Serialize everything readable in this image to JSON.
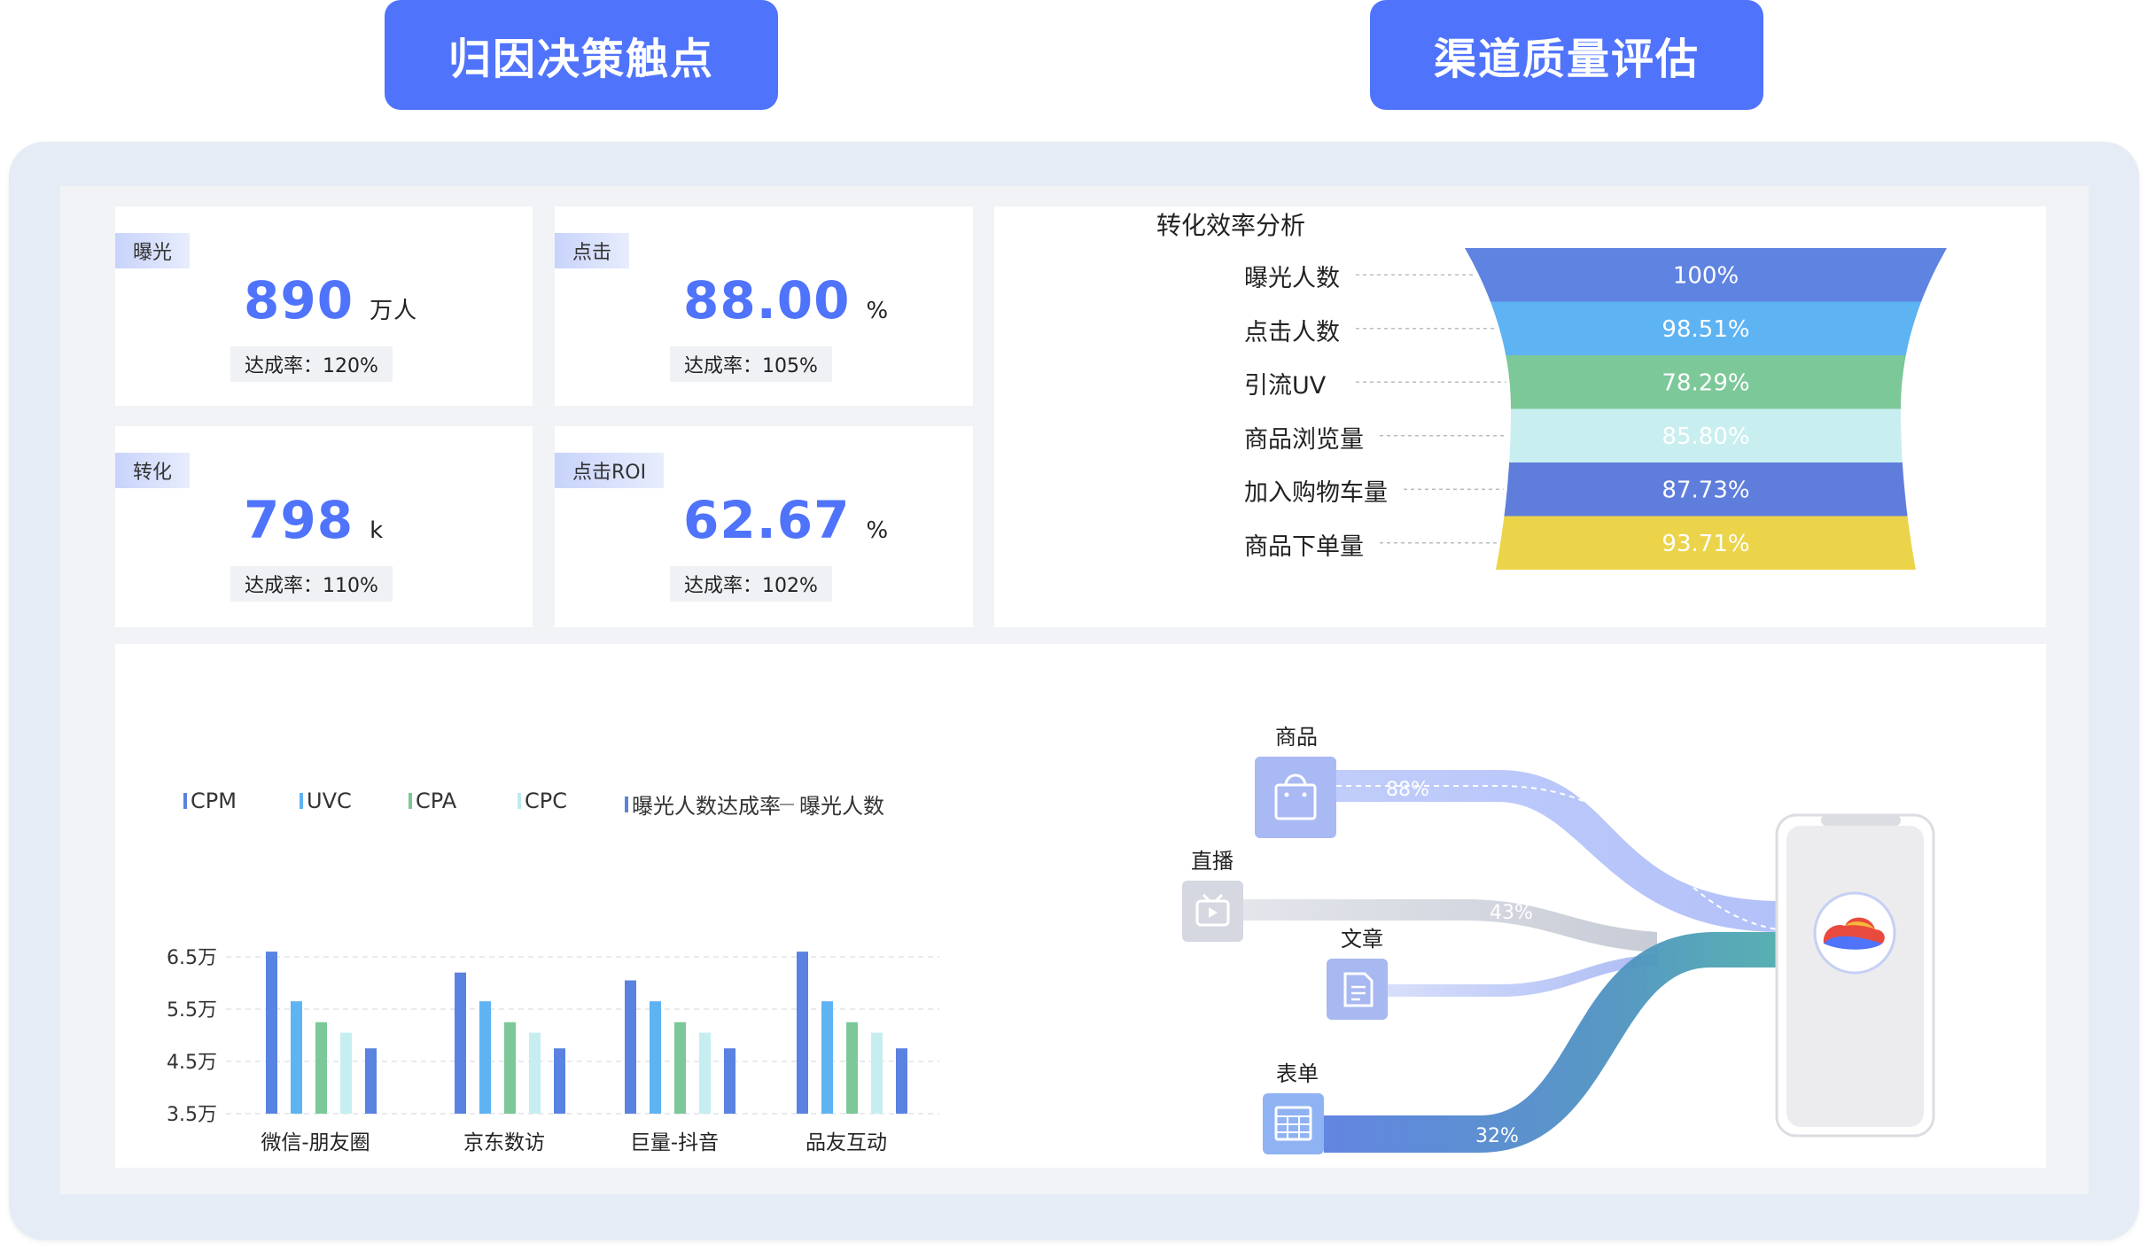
{
  "header": {
    "tab_left": "归因决策触点",
    "tab_right": "渠道质量评估"
  },
  "kpis": [
    {
      "tag": "曝光",
      "value": "890",
      "unit": "万人",
      "rate": "达成率：120%"
    },
    {
      "tag": "点击",
      "value": "88.00",
      "unit": "%",
      "rate": "达成率：105%"
    },
    {
      "tag": "转化",
      "value": "798",
      "unit": "k",
      "rate": "达成率：110%"
    },
    {
      "tag": "点击ROI",
      "value": "62.67",
      "unit": "%",
      "rate": "达成率：102%"
    }
  ],
  "funnel": {
    "title": "转化效率分析",
    "stages": [
      {
        "label": "曝光人数",
        "value": "100%",
        "color": "#5f83e0"
      },
      {
        "label": "点击人数",
        "value": "98.51%",
        "color": "#5eb3f3"
      },
      {
        "label": "引流UV",
        "value": "78.29%",
        "color": "#7cc898"
      },
      {
        "label": "商品浏览量",
        "value": "85.80%",
        "color": "#c9eef0"
      },
      {
        "label": "加入购物车量",
        "value": "87.73%",
        "color": "#5f7edc"
      },
      {
        "label": "商品下单量",
        "value": "93.71%",
        "color": "#ecd44a"
      }
    ]
  },
  "chart_data": {
    "type": "bar",
    "categories": [
      "微信-朋友圈",
      "京东数访",
      "巨量-抖音",
      "品友互动"
    ],
    "series": [
      {
        "name": "CPM",
        "values": [
          66000,
          62000,
          60500,
          66000
        ],
        "color": "#5a82e0"
      },
      {
        "name": "UVC",
        "values": [
          56500,
          56500,
          56500,
          56500
        ],
        "color": "#5eb3f3"
      },
      {
        "name": "CPA",
        "values": [
          52500,
          52500,
          52500,
          52500
        ],
        "color": "#7cc898"
      },
      {
        "name": "CPC",
        "values": [
          50500,
          50500,
          50500,
          50500
        ],
        "color": "#c6eef0"
      },
      {
        "name": "曝光人数达成率",
        "values": [
          47500,
          47500,
          47500,
          47500
        ],
        "color": "#5a82e0"
      }
    ],
    "legend": [
      {
        "name": "CPM",
        "color": "#5a82e0",
        "kind": "bar"
      },
      {
        "name": "UVC",
        "color": "#5eb3f3",
        "kind": "bar"
      },
      {
        "name": "CPA",
        "color": "#7cc898",
        "kind": "bar"
      },
      {
        "name": "CPC",
        "color": "#bfeaf0",
        "kind": "bar"
      },
      {
        "name": "曝光人数达成率",
        "color": "#5a82e0",
        "kind": "bar"
      },
      {
        "name": "曝光人数",
        "color": "#999999",
        "kind": "line"
      }
    ],
    "yticks": [
      "6.5万",
      "5.5万",
      "4.5万",
      "3.5万"
    ],
    "ytick_values": [
      65000,
      55000,
      45000,
      35000
    ],
    "ylim": [
      35000,
      70000
    ],
    "legend_position": "top",
    "grid": true
  },
  "sankey": {
    "sources": [
      {
        "label": "商品",
        "percent": "88%",
        "icon": "shopping-bag-icon"
      },
      {
        "label": "直播",
        "percent": "43%",
        "icon": "tv-play-icon"
      },
      {
        "label": "文章",
        "percent": "",
        "icon": "document-icon"
      },
      {
        "label": "表单",
        "percent": "32%",
        "icon": "table-icon"
      }
    ],
    "target_icon": "cloud-logo-icon"
  }
}
